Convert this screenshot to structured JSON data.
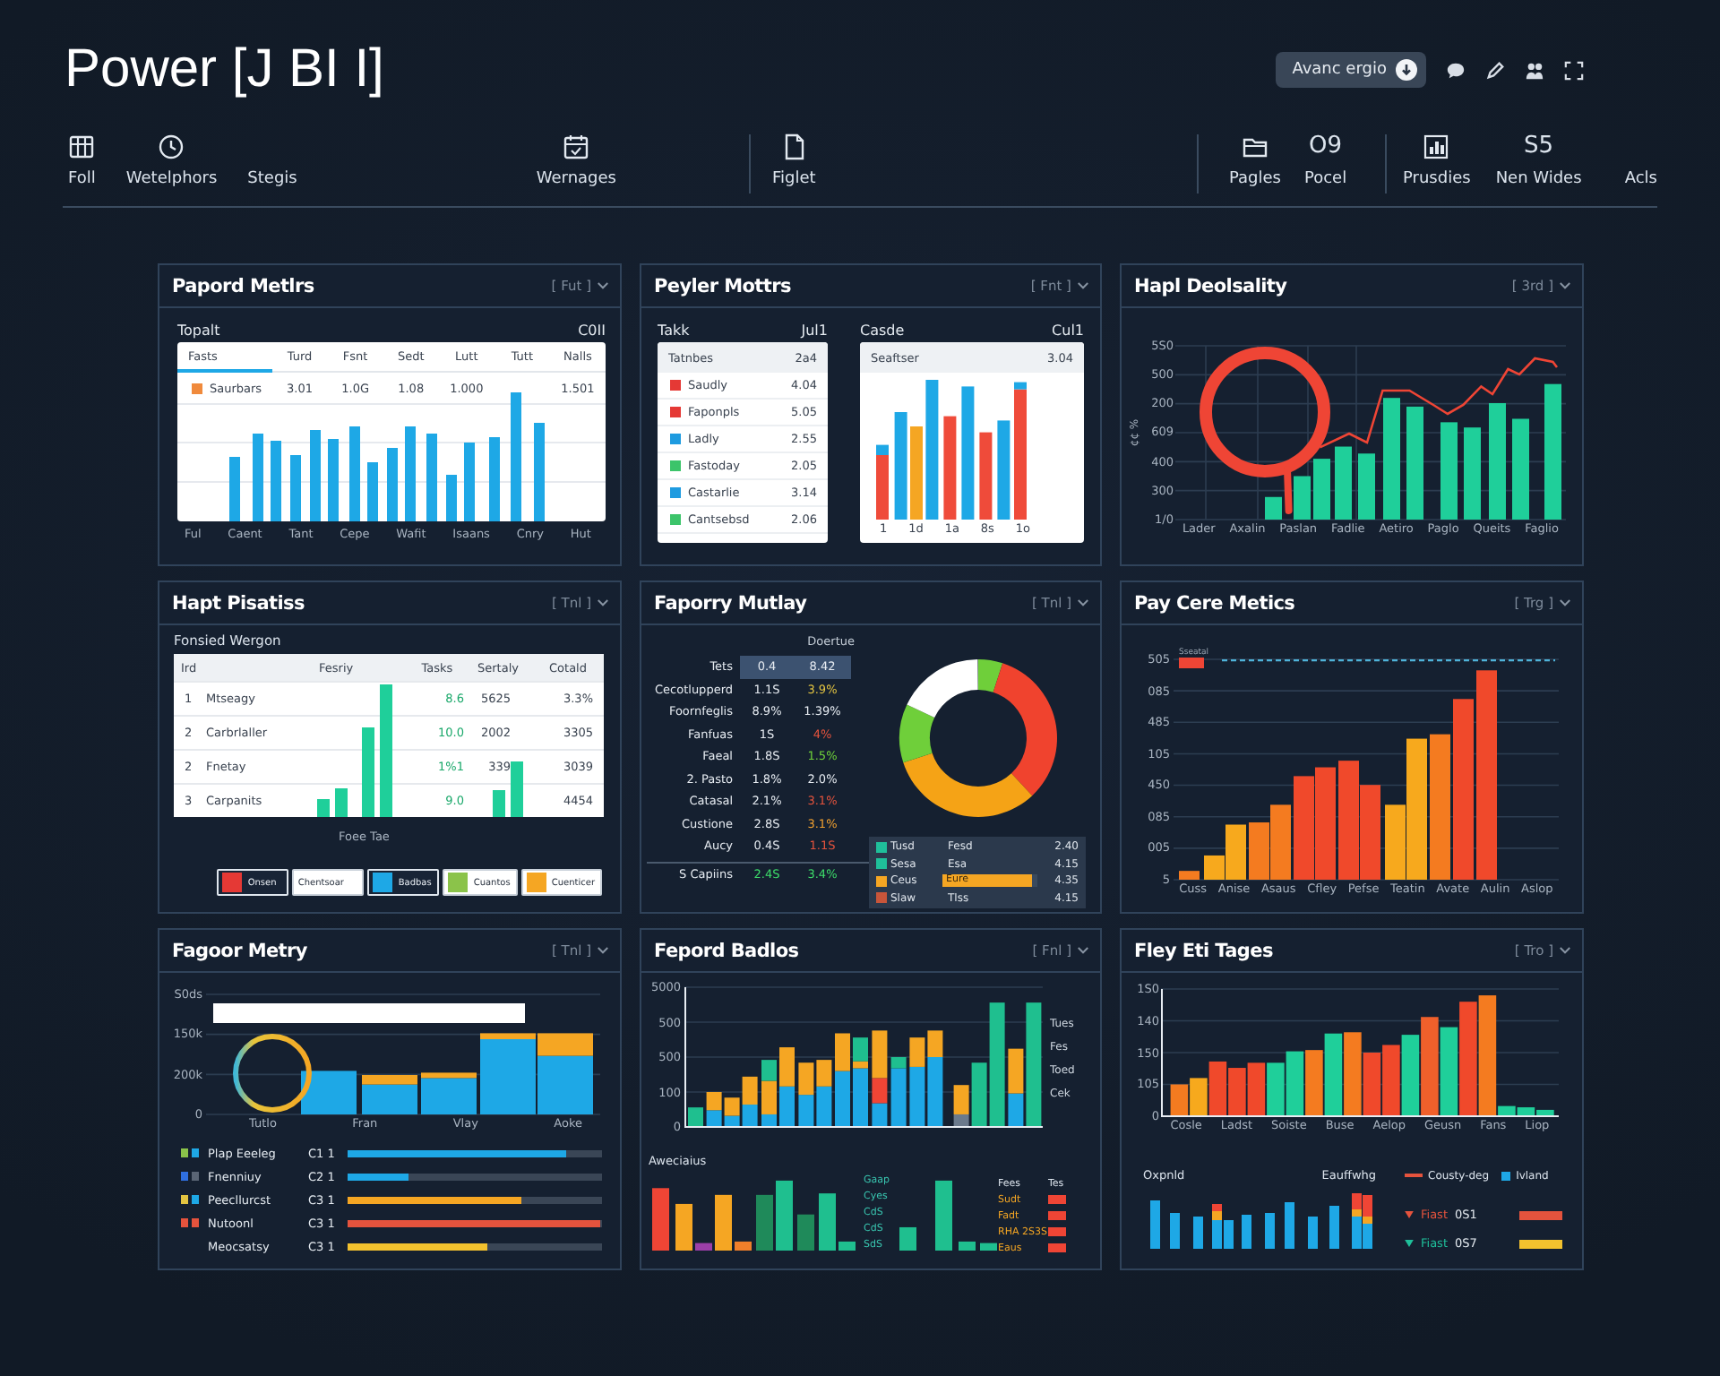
{
  "app": {
    "title": "Power [J BI I]",
    "action_button": "Avanc ergio"
  },
  "toolbar": [
    {
      "items": [
        {
          "kind": "icon",
          "label": "Foll"
        },
        {
          "kind": "icon",
          "label": "Wetelphors"
        },
        {
          "kind": "plain",
          "label": "Stegis"
        },
        {
          "kind": "icon",
          "label": "Wernages"
        }
      ]
    },
    {
      "items": [
        {
          "kind": "icon",
          "label": "Figlet"
        }
      ]
    },
    {
      "items": [
        {
          "kind": "icon",
          "label": "Pagles"
        },
        {
          "kind": "text",
          "top": "O9",
          "label": "Pocel"
        }
      ]
    },
    {
      "items": [
        {
          "kind": "icon",
          "label": "Prusdies"
        },
        {
          "kind": "text",
          "top": "S5",
          "label": "Nen Wides"
        },
        {
          "kind": "plain",
          "label": "Acls"
        }
      ]
    }
  ],
  "panels": [
    {
      "kind": "summary_bars",
      "title": "Papord Metlrs",
      "menu": "[ Fut ]",
      "left_label": "Topalt",
      "right_label": "C0II",
      "columns": [
        "Fasts",
        "Turd",
        "Fsnt",
        "Sedt",
        "Lutt",
        "Tutt",
        "Nalls"
      ],
      "row": {
        "label": "Saurbars",
        "values": [
          "3.01",
          "1.0G",
          "1.08",
          "1.000",
          "1.501"
        ]
      },
      "x_labels": [
        "Ful",
        "Caent",
        "Tant",
        "Cepe",
        "Wafit",
        "Isaans",
        "Cnry",
        "Hut"
      ]
    },
    {
      "kind": "split_cards",
      "title": "Peyler Mottrs",
      "menu": "[ Fnt ]",
      "table": {
        "label": "Takk",
        "value": "Jul1",
        "header": [
          "Tatnbes",
          "2a4"
        ],
        "rows": [
          {
            "label": "Saudly",
            "value": "4.04",
            "color": "#e53935"
          },
          {
            "label": "Faponpls",
            "value": "5.05",
            "color": "#e53935"
          },
          {
            "label": "Ladly",
            "value": "2.55",
            "color": "#1e9be0"
          },
          {
            "label": "Fastoday",
            "value": "2.05",
            "color": "#3cc46a"
          },
          {
            "label": "Castarlie",
            "value": "3.14",
            "color": "#1e9be0"
          },
          {
            "label": "Cantsebsd",
            "value": "2.06",
            "color": "#3cc46a"
          }
        ]
      },
      "chart": {
        "label": "Casde",
        "value": "Cul1",
        "header": [
          "Seaftser",
          "3.04"
        ],
        "x_labels": [
          "1",
          "1d",
          "1a",
          "8s",
          "1o"
        ]
      }
    },
    {
      "kind": "line_bars",
      "title": "Hapl Deolsality",
      "menu": "[ 3rd ]",
      "y_title": "¢¢ %",
      "y_ticks": [
        "5S0",
        "500",
        "200",
        "609",
        "400",
        "300",
        "1/0"
      ],
      "x_labels": [
        "Lader",
        "Axalin",
        "Paslan",
        "Fadlie",
        "Aetiro",
        "Paglo",
        "Queits",
        "Faglio"
      ]
    },
    {
      "kind": "ranked_table",
      "title": "Hapt Pisatiss",
      "menu": "[ Tnl ]",
      "subtitle": "Fonsied Wergon",
      "columns": [
        "Ird",
        "Fesriy",
        "Tasks",
        "Sertaly",
        "Cotald"
      ],
      "rows": [
        {
          "rank": "1",
          "name": "Mtseagy",
          "tasks": "8.6",
          "sertaly": "5625",
          "cotald": "3.3%"
        },
        {
          "rank": "2",
          "name": "Carbrlaller",
          "tasks": "10.0",
          "sertaly": "2002",
          "cotald": "3305"
        },
        {
          "rank": "2",
          "name": "Fnetay",
          "tasks": "1%1",
          "sertaly": "339",
          "cotald": "3039"
        },
        {
          "rank": "3",
          "name": "Carpanits",
          "tasks": "9.0",
          "cotald": "4454"
        }
      ],
      "caption": "Foee Tae",
      "legend": [
        {
          "label": "Onsen",
          "color": "#e53935",
          "selected": true
        },
        {
          "label": "Chentsoar",
          "selected": false
        },
        {
          "label": "Badbas",
          "color": "#1ea8e6",
          "selected": true
        },
        {
          "label": "Cuantos",
          "color": "#8bc34a",
          "selected": false
        },
        {
          "label": "Cuenticer",
          "color": "#f5a623",
          "selected": false
        }
      ]
    },
    {
      "kind": "table_donut",
      "title": "Faporry Mutlay",
      "menu": "[ Tnl ]",
      "header": "Doertue",
      "rows": [
        {
          "label": "Tets",
          "a": "0.4",
          "b": "8.42",
          "selected": true
        },
        {
          "label": "Cecotlupperd",
          "a": "1.1S",
          "b": "3.9%",
          "color": "#e3c441",
          "selected": false
        },
        {
          "label": "Foornfeglis",
          "a": "8.9%",
          "b": "1.39%",
          "selected": false
        },
        {
          "label": "Fanfuas",
          "a": "1S",
          "b": "4%",
          "color": "#e5533d",
          "selected": false
        },
        {
          "label": "Faeal",
          "a": "1.8S",
          "b": "1.5%",
          "color": "#6fd13a",
          "selected": false
        },
        {
          "label": "2. Pasto",
          "a": "1.8%",
          "b": "2.0%",
          "selected": false
        },
        {
          "label": "Catasal",
          "a": "2.1%",
          "b": "3.1%",
          "color": "#e5533d",
          "selected": false
        },
        {
          "label": "Custione",
          "a": "2.8S",
          "b": "3.1%",
          "color": "#f0a030",
          "selected": false
        },
        {
          "label": "Aucy",
          "a": "0.4S",
          "b": "1.1S",
          "color": "#e5533d",
          "selected": false
        }
      ],
      "total": {
        "label": "S Capiins",
        "a": "2.4S",
        "b": "3.4%"
      },
      "legend": [
        {
          "kind": "text",
          "label": "Tusd",
          "mid": "Fesd",
          "value": "2.40",
          "color": "#1fbf9a"
        },
        {
          "kind": "text",
          "label": "Sesa",
          "mid": "Esa",
          "value": "4.15",
          "color": "#1fbf9a"
        },
        {
          "kind": "bar",
          "label": "Ceus",
          "mid": "Eure",
          "level": 0.95,
          "value": "4.35",
          "color": "#f5a623"
        },
        {
          "kind": "text",
          "label": "Slaw",
          "mid": "Tlss",
          "value": "4.15",
          "color": "#c8553a"
        }
      ]
    },
    {
      "kind": "ramp_bars",
      "title": "Pay Cere Metics",
      "menu": "[ Trg ]",
      "legend_label": "Sseatal",
      "y_ticks": [
        "505",
        "085",
        "485",
        "105",
        "450",
        "085",
        "005",
        "5"
      ],
      "x_labels": [
        "Cuss",
        "Anise",
        "Asaus",
        "Cfley",
        "Pefse",
        "Teatin",
        "Avate",
        "Aulin",
        "Aslop"
      ]
    },
    {
      "kind": "ring_bars",
      "title": "Fagoor Metry",
      "menu": "[ Tnl ]",
      "y_ticks": [
        "S0ds",
        "150k",
        "200k",
        "0"
      ],
      "x_labels": [
        "Tutlo",
        "Fran",
        "Vlay",
        "Aoke"
      ],
      "rows": [
        {
          "label": "Plap Eeeleg",
          "value": "C1 1",
          "level": 0.86,
          "color": "#1ea8e6",
          "markers": [
            {
              "color": "#8bc34a"
            },
            {
              "color": "#1ea8e6"
            }
          ]
        },
        {
          "label": "Fnenniuy",
          "value": "C2 1",
          "level": 0.24,
          "color": "#1ea8e6",
          "markers": [
            {
              "color": "#2f6fe0"
            },
            {
              "color": "#5a6575"
            }
          ]
        },
        {
          "label": "Peecllurcst",
          "value": "C3 1",
          "level": 0.68,
          "color": "#f5a623",
          "markers": [
            {
              "color": "#e3c441"
            },
            {
              "color": "#1ea8e6"
            }
          ]
        },
        {
          "label": "Nutoonl",
          "value": "C3 1",
          "level": 0.99,
          "color": "#e5533d",
          "markers": [
            {
              "color": "#e5533d"
            },
            {
              "color": "#e5533d"
            }
          ]
        },
        {
          "label": "Meocsatsy",
          "value": "C3 1",
          "level": 0.55,
          "color": "#f2c12e"
        }
      ]
    },
    {
      "kind": "stacked_combo",
      "title": "Fepord Badlos",
      "menu": "[ Fnl ]",
      "y_ticks": [
        "5000",
        "500",
        "500",
        "100",
        "0"
      ],
      "side_labels": [
        "Tues",
        "Fes",
        "Toed",
        "Cek"
      ],
      "sub_title": "Aweciaius",
      "mid_labels": [
        "Gaap",
        "Cyes",
        "CdS",
        "CdS",
        "SdS"
      ],
      "legend_headers": [
        "Fees",
        "Tes"
      ],
      "legend": [
        "Sudt",
        "Fadt",
        "RHA 2S3S",
        "Eaus"
      ]
    },
    {
      "kind": "bars_legend",
      "title": "Fley Eti Tages",
      "menu": "[ Tro ]",
      "y_ticks": [
        "1S0",
        "140",
        "150",
        "105",
        "0"
      ],
      "x_labels": [
        "Cosle",
        "Ladst",
        "Soiste",
        "Buse",
        "Aelop",
        "Geusn",
        "Fans",
        "Liop"
      ],
      "left_label": "Oxpnld",
      "mid_label": "Eauffwhg",
      "legend": [
        {
          "kind": "line",
          "label": "Cousty-deg",
          "color": "#e5533d"
        },
        {
          "kind": "square",
          "label": "Ivland",
          "color": "#1ea8e6"
        }
      ],
      "rows": [
        {
          "label": "Fiast",
          "value": "0S1",
          "color": "#e5533d",
          "marker": {
            "color": "#e5533d"
          }
        },
        {
          "label": "Fiast",
          "value": "0S7",
          "color": "#f2c12e",
          "marker": {
            "color": "#1fbf9a"
          }
        }
      ]
    }
  ]
}
